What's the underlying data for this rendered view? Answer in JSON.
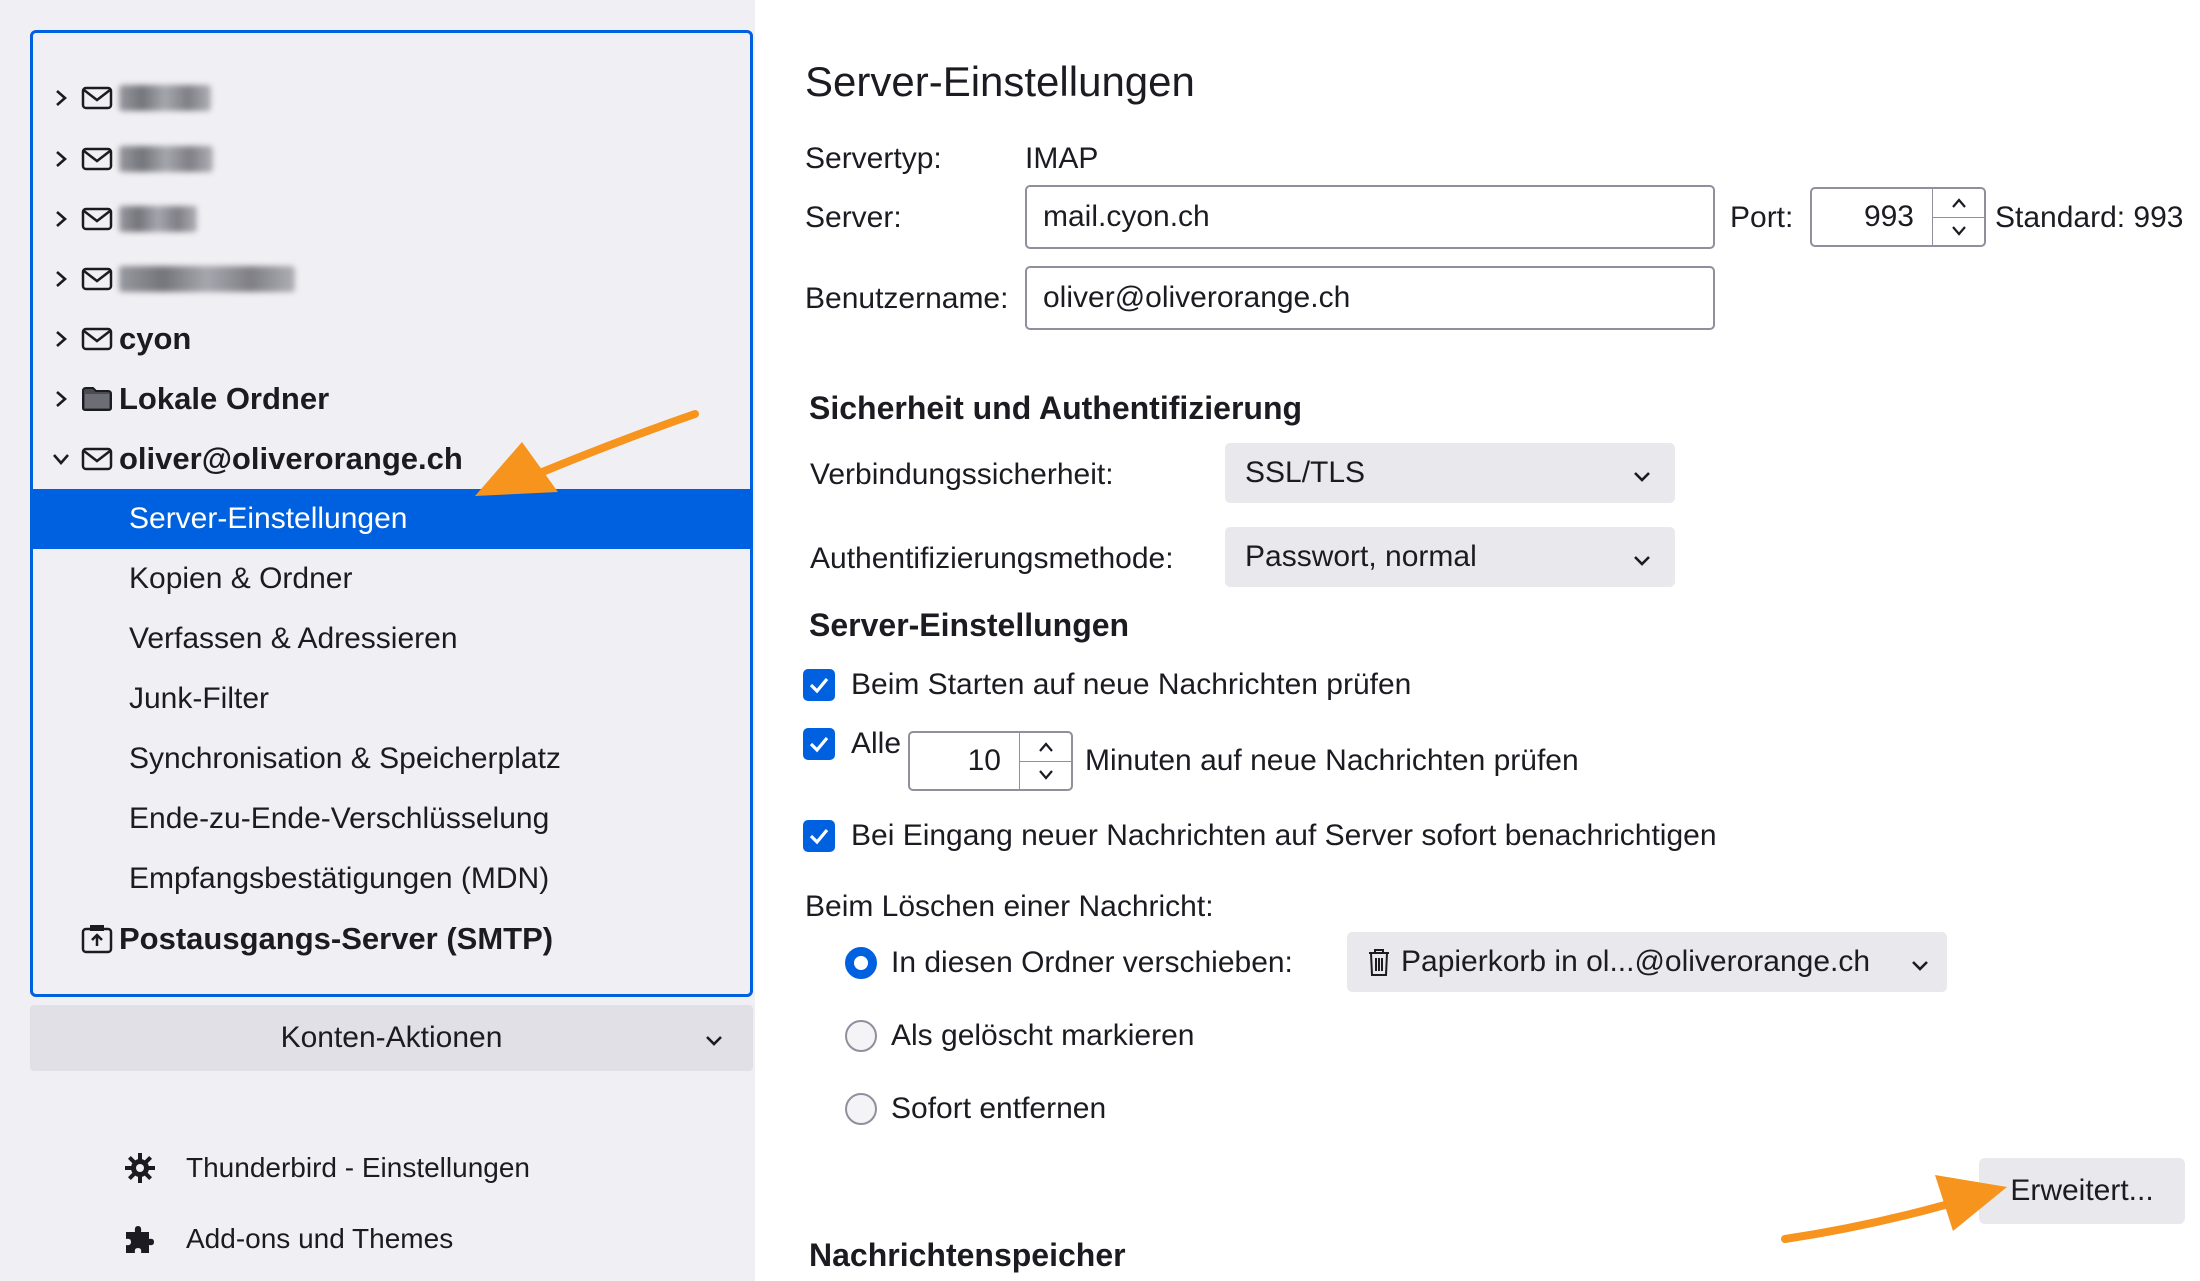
{
  "sidebar": {
    "accounts": [
      {
        "name": "",
        "obscured": true,
        "icon": "envelope-icon",
        "expanded": false
      },
      {
        "name": "",
        "obscured": true,
        "icon": "envelope-icon",
        "expanded": false
      },
      {
        "name": "",
        "obscured": true,
        "icon": "envelope-icon",
        "expanded": false
      },
      {
        "name": "",
        "obscured": true,
        "icon": "envelope-icon",
        "expanded": false
      },
      {
        "name": "cyon",
        "icon": "envelope-icon",
        "expanded": false
      },
      {
        "name": "Lokale Ordner",
        "icon": "folder-icon",
        "expanded": false
      },
      {
        "name": "oliver@oliverorange.ch",
        "icon": "envelope-icon",
        "expanded": true
      }
    ],
    "subitems": [
      {
        "label": "Server-Einstellungen",
        "selected": true
      },
      {
        "label": "Kopien & Ordner"
      },
      {
        "label": "Verfassen & Adressieren"
      },
      {
        "label": "Junk-Filter"
      },
      {
        "label": "Synchronisation & Speicherplatz"
      },
      {
        "label": "Ende-zu-Ende-Verschlüsselung"
      },
      {
        "label": "Empfangsbestätigungen (MDN)"
      }
    ],
    "smtp": {
      "label": "Postausgangs-Server (SMTP)",
      "icon": "outbox-icon"
    },
    "account_actions": "Konten-Aktionen",
    "links": [
      {
        "label": "Thunderbird - Einstellungen",
        "icon": "gear-icon"
      },
      {
        "label": "Add-ons und Themes",
        "icon": "puzzle-icon"
      }
    ],
    "selection_color": "#0061e0"
  },
  "main": {
    "title": "Server-Einstellungen",
    "server_type": {
      "label": "Servertyp:",
      "value": "IMAP"
    },
    "server": {
      "label": "Server:",
      "value": "mail.cyon.ch"
    },
    "port": {
      "label": "Port:",
      "value": "993",
      "default_text": "Standard: 993"
    },
    "username": {
      "label": "Benutzername:",
      "value": "oliver@oliverorange.ch"
    },
    "security_section": {
      "title": "Sicherheit und Authentifizierung",
      "connection": {
        "label": "Verbindungssicherheit:",
        "value": "SSL/TLS"
      },
      "auth": {
        "label": "Authentifizierungsmethode:",
        "value": "Passwort, normal"
      }
    },
    "server_section": {
      "title": "Server-Einstellungen",
      "check_on_start": {
        "label": "Beim Starten auf neue Nachrichten prüfen",
        "checked": true
      },
      "check_every": {
        "label_before": "Alle",
        "value": "10",
        "label_after": "Minuten auf neue Nachrichten prüfen",
        "checked": true
      },
      "notify": {
        "label": "Bei Eingang neuer Nachrichten auf Server sofort benachrichtigen",
        "checked": true
      },
      "delete_label": "Beim Löschen einer Nachricht:",
      "delete_options": [
        {
          "label": "In diesen Ordner verschieben:",
          "selected": true
        },
        {
          "label": "Als gelöscht markieren",
          "selected": false
        },
        {
          "label": "Sofort entfernen",
          "selected": false
        }
      ],
      "trash_folder": "Papierkorb in ol...@oliverorange.ch",
      "advanced_button": "Erweitert..."
    },
    "storage_title": "Nachrichtenspeicher"
  },
  "annotation_color": "#f7941d"
}
